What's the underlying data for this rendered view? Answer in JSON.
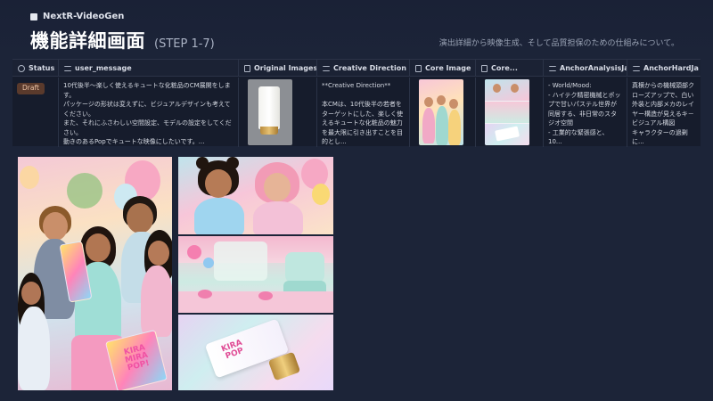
{
  "app": {
    "brand": "NextR-VideoGen"
  },
  "header": {
    "title": "機能詳細画面",
    "step": "(STEP 1-7)",
    "subtitle": "演出詳細から映像生成、そして品質担保のための仕組みについて。"
  },
  "table": {
    "columns": [
      {
        "label": "Status",
        "icon": "status-icon"
      },
      {
        "label": "user_message",
        "icon": "text-lines-icon"
      },
      {
        "label": "Original Images",
        "icon": "file-icon"
      },
      {
        "label": "Creative Direction",
        "icon": "text-lines-icon"
      },
      {
        "label": "Core Image",
        "icon": "file-icon"
      },
      {
        "label": "Core...",
        "icon": "file-icon"
      },
      {
        "label": "AnchorAnalysisJa",
        "icon": "text-lines-icon"
      },
      {
        "label": "AnchorHardJa",
        "icon": "text-lines-icon"
      }
    ],
    "row": {
      "status": "Draft",
      "user_message": "10代後半～楽しく使えるキュートな化粧品のCM展開をします。\nパッケージの形状は変えずに、ビジュアルデザインも考えてください。\nまた、それにふさわしい空間設定、モデルの設定をしてください。\n動きのあるPopでキュートな映像にしたいです。...",
      "creative_direction": "**Creative Direction**\n\n本CMは、10代後半の若者をターゲットにした、楽しく使えるキュートな化粧品の魅力を最大限に引き出すことを目的とし...",
      "anchor_analysis": "- World/Mood:\n- ハイテク精密機械とポップで甘いパステル世界が同居する、非日常のスタジオ空間\n- 工業的な緊張感と、10...",
      "anchor_hard": "真横からの機械頭部クローズアップで、白い外装と内部メカのレイヤー構造が見えるキ－ビジュアル構図\nキャラクターの過剰に..."
    }
  },
  "gallery": {
    "main_pack_text": "KIRA\nMIRA\nPOP!",
    "tube_text": "KIRA\nPOP"
  },
  "colors": {
    "background": "#1c2438",
    "badge_bg": "#5a3a2c",
    "badge_text": "#f0c7a9",
    "brand_pink": "#f052a3"
  }
}
